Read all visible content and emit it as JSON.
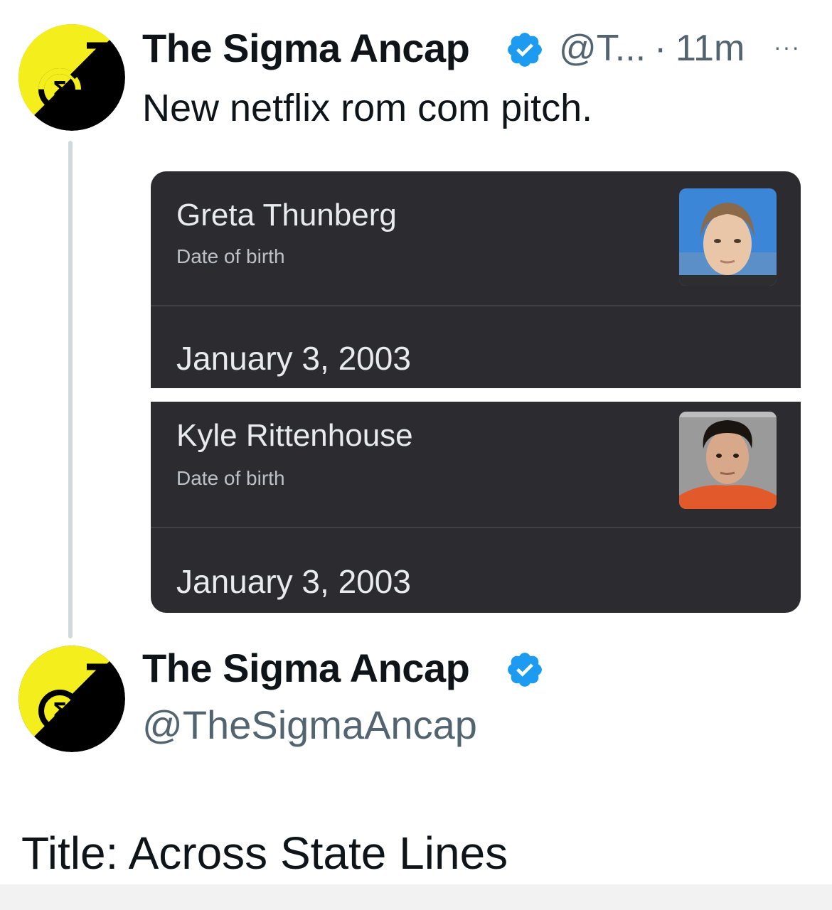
{
  "tweet": {
    "author_name": "The Sigma Ancap",
    "handle_truncated": "@T...",
    "separator": "·",
    "time": "11m",
    "more": "···",
    "text": "New netflix rom com pitch.",
    "avatar_icon": "ancap-sigma-logo-icon",
    "verified_icon": "verified-badge-icon",
    "accent_color": "#1d9bf0"
  },
  "embedded_image": {
    "cards": [
      {
        "name": "Greta Thunberg",
        "label": "Date of birth",
        "value": "January 3, 2003"
      },
      {
        "name": "Kyle Rittenhouse",
        "label": "Date of birth",
        "value": "January 3, 2003"
      }
    ]
  },
  "profile": {
    "author_name": "The Sigma Ancap",
    "handle": "@TheSigmaAncap"
  },
  "caption": "Title: Across State Lines"
}
